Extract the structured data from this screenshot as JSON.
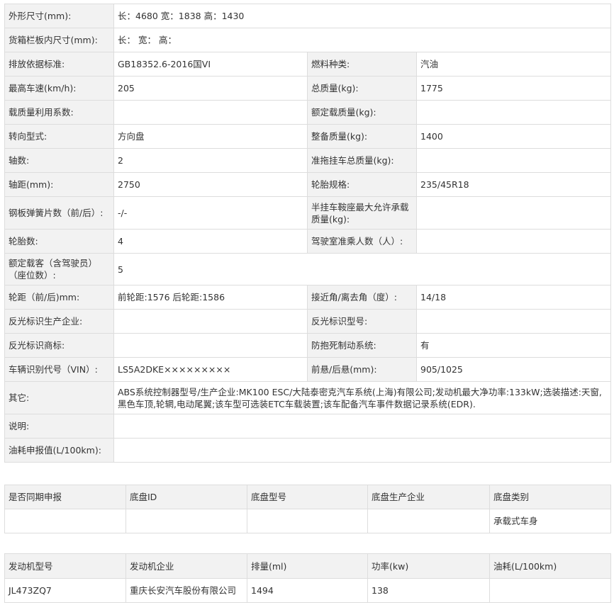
{
  "spec": {
    "outer_size": {
      "label": "外形尺寸(mm):",
      "value": "长：4680 宽：1838 高：1430"
    },
    "cargo_size": {
      "label": "货箱栏板内尺寸(mm):",
      "value": "长： 宽： 高："
    },
    "emission_std": {
      "label": "排放依据标准:",
      "value": "GB18352.6-2016国VI"
    },
    "fuel_type": {
      "label": "燃料种类:",
      "value": "汽油"
    },
    "max_speed": {
      "label": "最高车速(km/h):",
      "value": "205"
    },
    "total_mass": {
      "label": "总质量(kg):",
      "value": "1775"
    },
    "load_util": {
      "label": "载质量利用系数:",
      "value": ""
    },
    "rated_load": {
      "label": "额定载质量(kg):",
      "value": ""
    },
    "steering": {
      "label": "转向型式:",
      "value": "方向盘"
    },
    "curb_mass": {
      "label": "整备质量(kg):",
      "value": "1400"
    },
    "axles": {
      "label": "轴数:",
      "value": "2"
    },
    "trailer_mass": {
      "label": "准拖挂车总质量(kg):",
      "value": ""
    },
    "wheelbase": {
      "label": "轴距(mm):",
      "value": "2750"
    },
    "tire_spec": {
      "label": "轮胎规格:",
      "value": "235/45R18"
    },
    "leaf_springs": {
      "label": "钢板弹簧片数（前/后）:",
      "value": "-/-"
    },
    "saddle_load": {
      "label": "半挂车鞍座最大允许承载质量(kg):",
      "value": ""
    },
    "tires": {
      "label": "轮胎数:",
      "value": "4"
    },
    "cab_seats": {
      "label": "驾驶室准乘人数（人）:",
      "value": ""
    },
    "passengers": {
      "label": "额定载客（含驾驶员）（座位数）:",
      "value": "5"
    },
    "track": {
      "label": "轮距（前/后)mm:",
      "value": "前轮距:1576 后轮距:1586"
    },
    "angles": {
      "label": "接近角/离去角（度）:",
      "value": "14/18"
    },
    "reflect_maker": {
      "label": "反光标识生产企业:",
      "value": ""
    },
    "reflect_model": {
      "label": "反光标识型号:",
      "value": ""
    },
    "reflect_brand": {
      "label": "反光标识商标:",
      "value": ""
    },
    "abs": {
      "label": "防抱死制动系统:",
      "value": "有"
    },
    "vin": {
      "label": "车辆识别代号（VIN）:",
      "value": "LS5A2DKE×××××××××"
    },
    "overhang": {
      "label": "前悬/后悬(mm):",
      "value": "905/1025"
    },
    "other": {
      "label": "其它:",
      "value": "ABS系统控制器型号/生产企业:MK100 ESC/大陆泰密克汽车系统(上海)有限公司;发动机最大净功率:133kW;选装描述:天窗,黑色车顶,轮辋,电动尾翼;该车型可选装ETC车载装置;该车配备汽车事件数据记录系统(EDR)."
    },
    "notes": {
      "label": "说明:",
      "value": ""
    },
    "fuel_report": {
      "label": "油耗申报值(L/100km):",
      "value": ""
    }
  },
  "chassis": {
    "headers": [
      "是否同期申报",
      "底盘ID",
      "底盘型号",
      "底盘生产企业",
      "底盘类别"
    ],
    "row": [
      "",
      "",
      "",
      "",
      "承载式车身"
    ]
  },
  "engine": {
    "headers": [
      "发动机型号",
      "发动机企业",
      "排量(ml)",
      "功率(kw)",
      "油耗(L/100km)"
    ],
    "row": [
      "JL473ZQ7",
      "重庆长安汽车股份有限公司",
      "1494",
      "138",
      ""
    ]
  }
}
